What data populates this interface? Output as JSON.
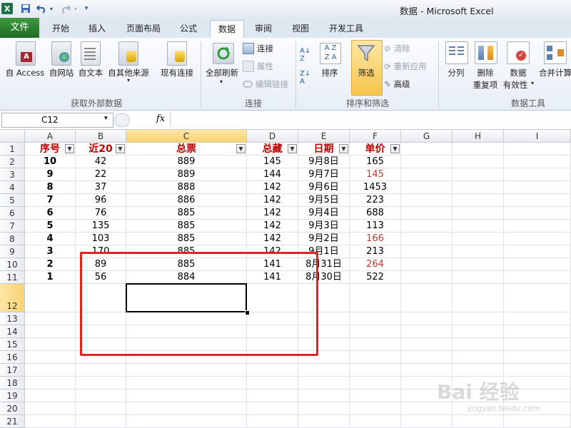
{
  "window": {
    "title": "数据 - Microsoft Excel",
    "app_icon": "excel-icon"
  },
  "qat": {
    "save_icon": "save-icon",
    "undo_icon": "undo-icon",
    "redo_icon": "redo-icon",
    "customize_icon": "dropdown-icon"
  },
  "tabs": [
    {
      "label": "文件"
    },
    {
      "label": "开始"
    },
    {
      "label": "插入"
    },
    {
      "label": "页面布局"
    },
    {
      "label": "公式"
    },
    {
      "label": "数据"
    },
    {
      "label": "审阅"
    },
    {
      "label": "视图"
    },
    {
      "label": "开发工具"
    }
  ],
  "active_tab": "数据",
  "ribbon": {
    "external": {
      "access": "自 Access",
      "web": "自网站",
      "text": "自文本",
      "other": "自其他来源",
      "existing": "现有连接",
      "group": "获取外部数据"
    },
    "connections": {
      "refresh_all": "全部刷新",
      "connections": "连接",
      "properties": "属性",
      "edit_links": "编辑链接",
      "group": "连接"
    },
    "sort_filter": {
      "sort": "排序",
      "filter": "筛选",
      "clear": "清除",
      "reapply": "重新应用",
      "advanced": "高级",
      "group": "排序和筛选"
    },
    "data_tools": {
      "split": "分列",
      "remove_dup_1": "删除",
      "remove_dup_2": "重复项",
      "validation_1": "数据",
      "validation_2": "有效性",
      "consolidate": "合并计算",
      "group": "数据工具"
    }
  },
  "formula_bar": {
    "name_box": "C12",
    "fx": "fx",
    "formula": ""
  },
  "columns": [
    "A",
    "B",
    "C",
    "D",
    "E",
    "F",
    "G",
    "H",
    "I"
  ],
  "row_numbers": [
    "1",
    "2",
    "3",
    "4",
    "5",
    "6",
    "7",
    "8",
    "9",
    "10",
    "11",
    "12",
    "13",
    "14",
    "15",
    "16",
    "17",
    "18",
    "19",
    "20",
    "21"
  ],
  "headers": [
    "序号",
    "近20",
    "总票",
    "总藏",
    "日期",
    "单价"
  ],
  "rows": [
    {
      "a": "10",
      "b": "42",
      "c": "889",
      "d": "145",
      "e": "9月8日",
      "f": "165",
      "f_red": false
    },
    {
      "a": "9",
      "b": "22",
      "c": "889",
      "d": "144",
      "e": "9月7日",
      "f": "145",
      "f_red": true
    },
    {
      "a": "8",
      "b": "37",
      "c": "888",
      "d": "142",
      "e": "9月6日",
      "f": "1453",
      "f_red": false
    },
    {
      "a": "7",
      "b": "96",
      "c": "886",
      "d": "142",
      "e": "9月5日",
      "f": "223",
      "f_red": false
    },
    {
      "a": "6",
      "b": "76",
      "c": "885",
      "d": "142",
      "e": "9月4日",
      "f": "688",
      "f_red": false
    },
    {
      "a": "5",
      "b": "135",
      "c": "885",
      "d": "142",
      "e": "9月3日",
      "f": "113",
      "f_red": false
    },
    {
      "a": "4",
      "b": "103",
      "c": "885",
      "d": "142",
      "e": "9月2日",
      "f": "166",
      "f_red": true
    },
    {
      "a": "3",
      "b": "170",
      "c": "885",
      "d": "142",
      "e": "9月1日",
      "f": "213",
      "f_red": false
    },
    {
      "a": "2",
      "b": "89",
      "c": "885",
      "d": "141",
      "e": "8月31日",
      "f": "264",
      "f_red": true
    },
    {
      "a": "1",
      "b": "56",
      "c": "884",
      "d": "141",
      "e": "8月30日",
      "f": "522",
      "f_red": false
    }
  ],
  "selected_cell": "C12",
  "watermark": {
    "brand": "Bai 经验",
    "url": "jingyan.baidu.com"
  },
  "colors": {
    "file_tab": "#2f7d32",
    "header_text": "#c00000",
    "annotation_box": "#e02424",
    "selection": "#000000"
  }
}
